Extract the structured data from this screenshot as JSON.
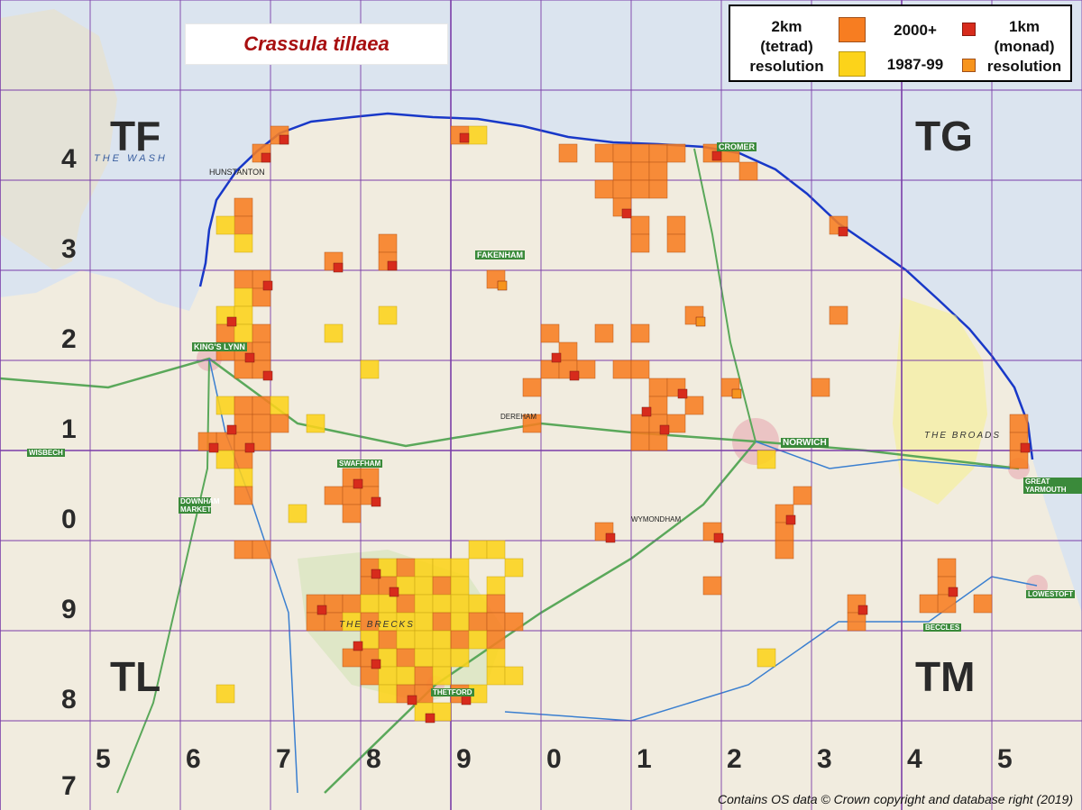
{
  "title": "Crassula tillaea",
  "legend": {
    "tetrad_line1": "2km",
    "tetrad_line2": "(tetrad)",
    "tetrad_line3": "resolution",
    "period_recent": "2000+",
    "period_old": "1987-99",
    "monad_line1": "1km",
    "monad_line2": "(monad)",
    "monad_line3": "resolution"
  },
  "colors": {
    "recent_tetrad": "#f77d21",
    "old_tetrad": "#fcd31a",
    "recent_monad": "#d72b1c",
    "monad_orange": "#f7941d",
    "grid_line": "#7a3da8",
    "coast": "#1838c8",
    "land": "#f1ecdf",
    "sea": "#dbe4ef"
  },
  "grid_squares": {
    "TF": "TF",
    "TG": "TG",
    "TL": "TL",
    "TM": "TM"
  },
  "northing_labels": [
    "4",
    "3",
    "2",
    "1",
    "0",
    "9",
    "8",
    "7"
  ],
  "easting_labels": [
    "5",
    "6",
    "7",
    "8",
    "9",
    "0",
    "1",
    "2",
    "3",
    "4",
    "5"
  ],
  "credit": "Contains OS data © Crown copyright and database right (2019)",
  "map_places": [
    "HUNSTANTON",
    "KING'S LYNN",
    "FAKENHAM",
    "CROMER",
    "NORWICH",
    "GREAT YARMOUTH",
    "LOWESTOFT",
    "THETFORD",
    "DEREHAM",
    "SWAFFHAM",
    "DOWNHAM MARKET",
    "WISBECH",
    "THE WASH",
    "THE BROADS",
    "THE BRECKS",
    "WYMONDHAM",
    "BECCLES"
  ]
}
